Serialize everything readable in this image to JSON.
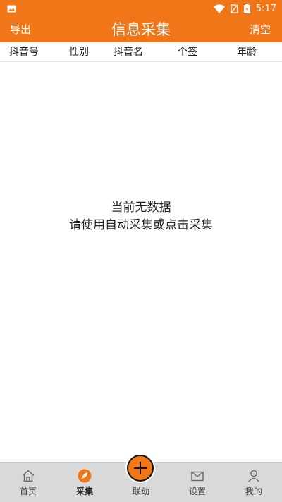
{
  "colors": {
    "brand_orange": "#f07617",
    "nav_background": "#d9d9d9",
    "text_dark": "#222222"
  },
  "status_bar": {
    "time": "5:17",
    "icons": [
      "image-notification-icon",
      "wifi-icon",
      "no-sim-icon",
      "battery-charging-icon"
    ]
  },
  "header": {
    "left_action": "导出",
    "title": "信息采集",
    "right_action": "清空"
  },
  "table": {
    "columns": [
      "抖音号",
      "性别",
      "抖音名",
      "个签",
      "年龄"
    ]
  },
  "empty_state": {
    "line1": "当前无数据",
    "line2": "请使用自动采集或点击采集"
  },
  "bottom_nav": {
    "active": "采集",
    "items": [
      {
        "label": "首页",
        "icon": "home-icon"
      },
      {
        "label": "采集",
        "icon": "feather-icon"
      },
      {
        "label": "联动",
        "icon": "plus-icon"
      },
      {
        "label": "设置",
        "icon": "mail-icon"
      },
      {
        "label": "我的",
        "icon": "user-icon"
      }
    ]
  }
}
